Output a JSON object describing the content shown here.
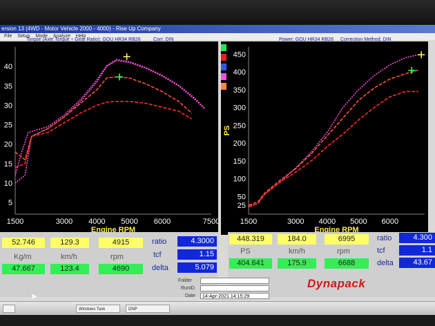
{
  "window": {
    "title": "ersion 13 (4WD - Motor Vehicle 2000 - 4000) - Rise Up Company",
    "menu": [
      "File",
      "Setup",
      "Mode",
      "Analyze",
      "Help"
    ]
  },
  "left_header": {
    "text": "Torque (Axle Torque ÷ Gear Ratio): GOU HR34 RB26",
    "corr": "Corr: DIN"
  },
  "right_header": {
    "power": "Power: GOU HR34 RB26",
    "correction": "Correction Method: DIN"
  },
  "colors": {
    "pink": "#ff4fd8",
    "orange": "#ff5533",
    "red": "#ff2a2a",
    "ticks": "#ffffff",
    "axis_label": "#ffee33"
  },
  "left_readout": {
    "row1": {
      "kgm": "52.746",
      "kmh": "129.3",
      "rpm": "4915"
    },
    "units": {
      "kgm": "Kg/m",
      "kmh": "km/h",
      "rpm": "rpm"
    },
    "row2": {
      "kgm": "47.667",
      "kmh": "123.4",
      "rpm": "4690"
    },
    "labels": {
      "ratio": "ratio",
      "tcf": "tcf",
      "delta": "delta"
    },
    "values": {
      "ratio": "4.3000",
      "tcf": "1.15",
      "delta": "5.079"
    }
  },
  "right_readout": {
    "row1": {
      "ps": "448.319",
      "kmh": "184.0",
      "rpm": "6995"
    },
    "units": {
      "ps": "PS",
      "kmh": "km/h",
      "rpm": "rpm"
    },
    "row2": {
      "ps": "404.641",
      "kmh": "175.9",
      "rpm": "6688"
    },
    "labels": {
      "ratio": "ratio",
      "tcf": "tcf",
      "delta": "delta"
    },
    "values": {
      "ratio": "4.300",
      "tcf": "1.1",
      "delta": "43.67"
    }
  },
  "info": {
    "folder_label": "Folder",
    "runid_label": "RunID",
    "date_label": "Date",
    "date_value": "14-Apr-2021 14:15:29"
  },
  "logo": "Dynapack",
  "taskbar": [
    "Windows Task Manager",
    "DNP"
  ],
  "chart_data": [
    {
      "type": "line",
      "title": "Torque (Axle Torque ÷ Gear Ratio): GOU HR34 RB26",
      "xlabel": "Engine RPM",
      "ylabel": "",
      "xlim": [
        1500,
        7500
      ],
      "ylim": [
        2,
        45
      ],
      "x_ticks": [
        1500,
        3000,
        4000,
        5000,
        6000,
        7500
      ],
      "y_ticks": [
        5,
        10,
        15,
        20,
        25,
        30,
        35,
        40
      ],
      "y_tick_labels": [
        "5",
        "10",
        "15",
        "20",
        "25",
        "30",
        "35",
        "40"
      ],
      "series": [
        {
          "color": "pink",
          "style": "dotted",
          "x": [
            1500,
            1800,
            2000,
            2500,
            3000,
            3500,
            4000,
            4300,
            4600,
            5000,
            5500,
            6000,
            6500,
            7000,
            7300
          ],
          "y": [
            10,
            12,
            22,
            24,
            27,
            31,
            36,
            40,
            41.5,
            41,
            39.5,
            37.5,
            35,
            31.5,
            29
          ]
        },
        {
          "color": "pink",
          "style": "dotted",
          "x": [
            1500,
            1700,
            1900,
            2500,
            3000,
            3500,
            4000,
            4300,
            4600,
            5000,
            5500,
            6000,
            6500,
            7000,
            7300
          ],
          "y": [
            12,
            18,
            23,
            24.5,
            27.5,
            31.5,
            36.5,
            40.2,
            41.8,
            41.2,
            39.7,
            37.7,
            35.2,
            31.8,
            29.2
          ]
        },
        {
          "color": "orange",
          "style": "dashed",
          "x": [
            1500,
            1800,
            2000,
            2500,
            3000,
            3500,
            4000,
            4300,
            4600,
            5000,
            5500,
            6000,
            6500,
            6900
          ],
          "y": [
            18,
            16,
            22,
            24,
            27,
            30.5,
            34,
            37,
            37.3,
            37,
            35.5,
            33.5,
            31,
            28
          ]
        },
        {
          "color": "red",
          "style": "dashed",
          "x": [
            1500,
            1800,
            2000,
            2500,
            3000,
            3500,
            4000,
            4300,
            4600,
            5000,
            5500,
            6000,
            6500,
            6900
          ],
          "y": [
            14,
            15,
            22,
            23,
            25.5,
            28,
            30,
            30.8,
            31,
            31,
            30.5,
            29.5,
            28.5,
            26.5
          ]
        }
      ],
      "markers": [
        {
          "x": 4915,
          "y": 42.5,
          "color": "yellow"
        },
        {
          "x": 4690,
          "y": 37.3,
          "color": "green"
        }
      ]
    },
    {
      "type": "line",
      "title": "Power: GOU HR34 RB26",
      "xlabel": "Engine RPM",
      "ylabel": "PS",
      "xlim": [
        1500,
        7100
      ],
      "ylim": [
        0,
        470
      ],
      "x_ticks": [
        1500,
        3000,
        4000,
        5000,
        6000
      ],
      "y_ticks": [
        25,
        50,
        100,
        150,
        200,
        250,
        300,
        350,
        400,
        450
      ],
      "y_tick_labels": [
        "25",
        "50",
        "100",
        "150",
        "200",
        "250",
        "300",
        "350",
        "400",
        "450"
      ],
      "series": [
        {
          "color": "pink",
          "style": "dotted",
          "x": [
            1500,
            1800,
            2000,
            2500,
            3000,
            3500,
            4000,
            4500,
            5000,
            5500,
            6000,
            6500,
            7000
          ],
          "y": [
            22,
            30,
            55,
            90,
            130,
            175,
            230,
            300,
            350,
            390,
            420,
            440,
            450
          ]
        },
        {
          "color": "orange",
          "style": "dashed",
          "x": [
            1500,
            1800,
            2000,
            2500,
            3000,
            3500,
            4000,
            4500,
            5000,
            5500,
            6000,
            6500,
            6900
          ],
          "y": [
            25,
            35,
            58,
            95,
            128,
            170,
            220,
            270,
            320,
            355,
            380,
            395,
            405
          ]
        },
        {
          "color": "red",
          "style": "dashed",
          "x": [
            1500,
            1800,
            2000,
            2500,
            3000,
            3500,
            4000,
            4500,
            5000,
            5500,
            6000,
            6500,
            6900
          ],
          "y": [
            20,
            30,
            55,
            90,
            118,
            150,
            190,
            225,
            265,
            300,
            330,
            345,
            345
          ]
        }
      ],
      "markers": [
        {
          "x": 6995,
          "y": 448,
          "color": "yellow"
        },
        {
          "x": 6688,
          "y": 404,
          "color": "green"
        }
      ]
    }
  ]
}
